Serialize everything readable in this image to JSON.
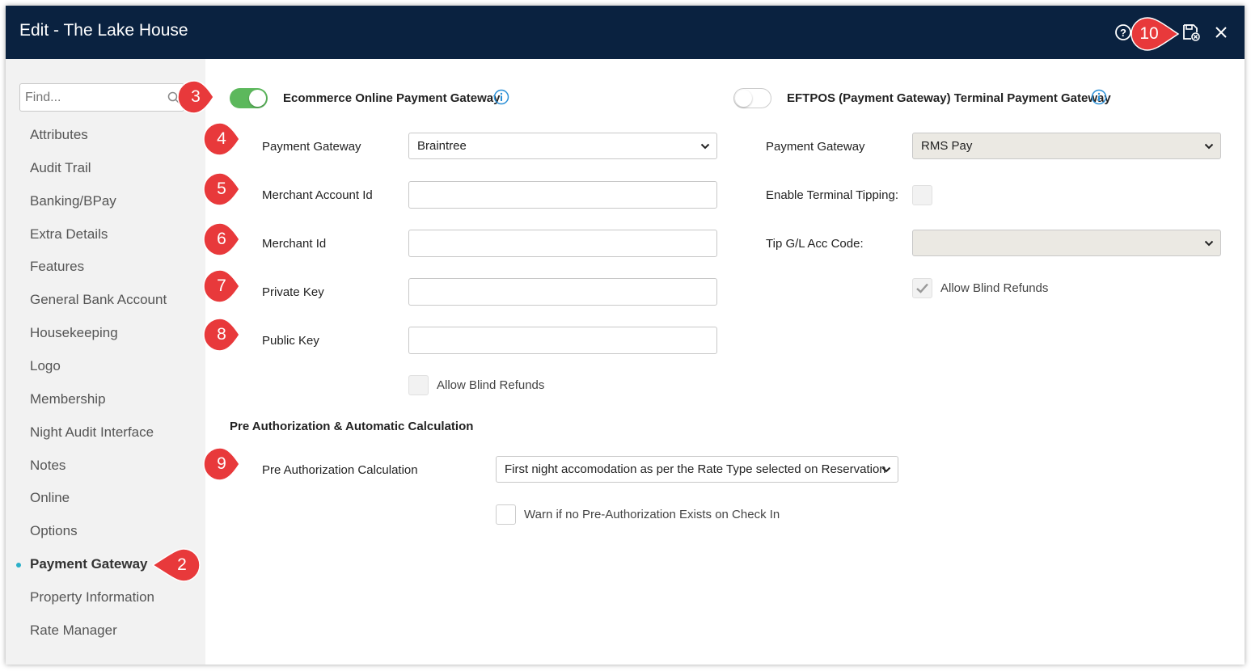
{
  "window": {
    "title": "Edit - The Lake House",
    "icons": [
      "help-icon",
      "save-close-icon",
      "close-icon"
    ]
  },
  "sidebar": {
    "search_placeholder": "Find...",
    "items": [
      {
        "label": "Attributes"
      },
      {
        "label": "Audit Trail"
      },
      {
        "label": "Banking/BPay"
      },
      {
        "label": "Extra Details"
      },
      {
        "label": "Features"
      },
      {
        "label": "General Bank Account"
      },
      {
        "label": "Housekeeping"
      },
      {
        "label": "Logo"
      },
      {
        "label": "Membership"
      },
      {
        "label": "Night Audit Interface"
      },
      {
        "label": "Notes"
      },
      {
        "label": "Online"
      },
      {
        "label": "Options"
      },
      {
        "label": "Payment Gateway",
        "active": true
      },
      {
        "label": "Property Information"
      },
      {
        "label": "Rate Manager"
      }
    ]
  },
  "ecommerce": {
    "toggle_label": "Ecommerce Online Payment Gateway",
    "toggle_on": true,
    "payment_gateway_label": "Payment Gateway",
    "payment_gateway_value": "Braintree",
    "merchant_account_id_label": "Merchant Account Id",
    "merchant_account_id_value": "",
    "merchant_id_label": "Merchant Id",
    "merchant_id_value": "",
    "private_key_label": "Private Key",
    "private_key_value": "",
    "public_key_label": "Public Key",
    "public_key_value": "",
    "allow_blind_refunds_label": "Allow Blind Refunds",
    "allow_blind_refunds_checked": false
  },
  "eftpos": {
    "toggle_label": "EFTPOS (Payment Gateway) Terminal Payment Gateway",
    "toggle_on": false,
    "payment_gateway_label": "Payment Gateway",
    "payment_gateway_value": "RMS Pay",
    "enable_tipping_label": "Enable Terminal Tipping:",
    "tip_acc_code_label": "Tip G/L Acc Code:",
    "tip_acc_code_value": "",
    "allow_blind_refunds_label": "Allow Blind Refunds",
    "allow_blind_refunds_checked": true
  },
  "preauth": {
    "section_title": "Pre Authorization & Automatic Calculation",
    "calculation_label": "Pre Authorization Calculation",
    "calculation_value": "First night accomodation as per the Rate Type selected on Reservation",
    "warn_label": "Warn if no Pre-Authorization Exists on Check In",
    "warn_checked": false
  },
  "callouts": [
    "2",
    "3",
    "4",
    "5",
    "6",
    "7",
    "8",
    "9",
    "10"
  ],
  "colors": {
    "titlebar": "#0a2240",
    "toggle_on": "#5cb85c",
    "callout": "#e8393b",
    "info": "#2a8fd6",
    "active_dot": "#2bb0c9"
  }
}
